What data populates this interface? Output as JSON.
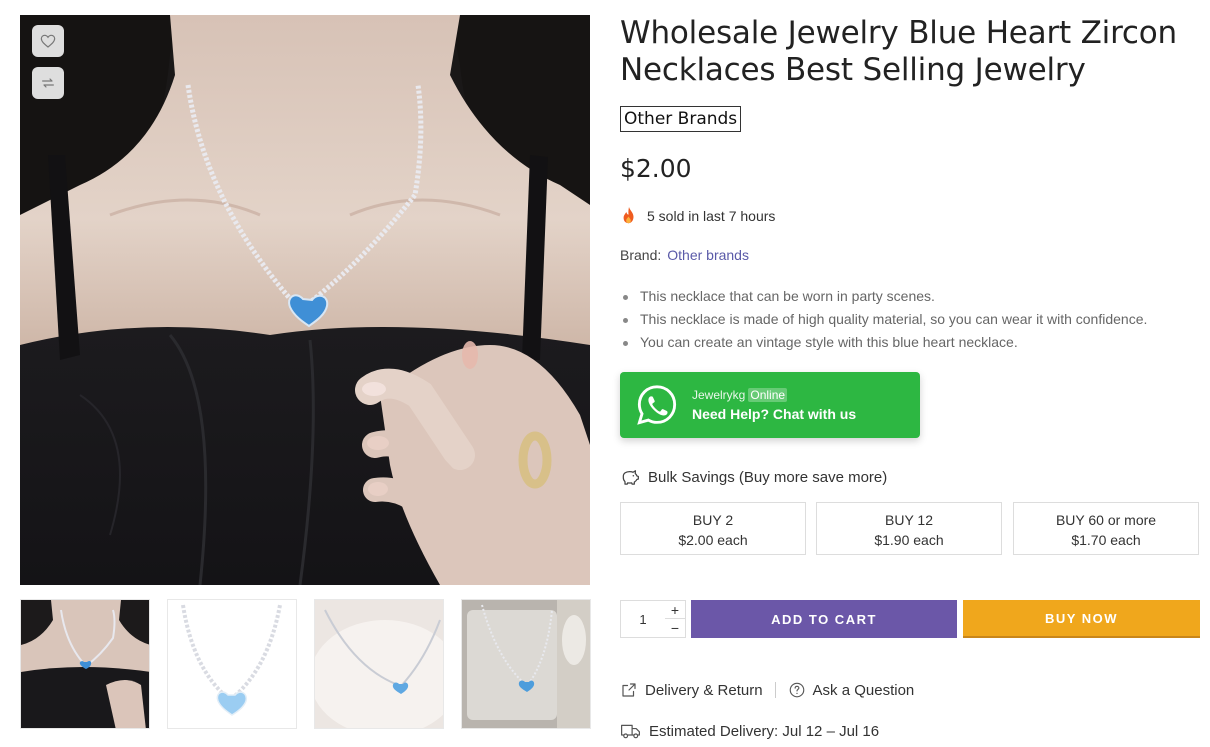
{
  "product": {
    "title": "Wholesale Jewelry Blue Heart Zircon Necklaces Best Selling Jewelry",
    "brand_tag": "Other Brands",
    "price": "$2.00",
    "sold_text": "5 sold in last 7 hours",
    "brand_label": "Brand:",
    "brand_link": "Other brands",
    "bullets": [
      "This necklace that can be worn in party scenes.",
      "This necklace is made of high quality material, so you can wear it with confidence.",
      "You can create an vintage style with this blue heart necklace."
    ]
  },
  "whatsapp": {
    "name": "Jewelrykg",
    "status": "Online",
    "help": "Need Help? Chat with us",
    "color": "#2db742"
  },
  "bulk": {
    "title": "Bulk Savings (Buy more save more)",
    "options": [
      {
        "qty": "BUY 2",
        "price": "$2.00 each"
      },
      {
        "qty": "BUY 12",
        "price": "$1.90 each"
      },
      {
        "qty": "BUY 60 or more",
        "price": "$1.70 each"
      }
    ]
  },
  "cart": {
    "quantity": "1",
    "plus": "+",
    "minus": "−",
    "add_to_cart": "ADD TO CART",
    "buy_now": "BUY NOW",
    "add_color": "#6b57a8",
    "buy_color": "#f0a71c"
  },
  "links": {
    "delivery_return": "Delivery & Return",
    "ask_question": "Ask a Question",
    "estimated_delivery": "Estimated Delivery: Jul 12 – Jul 16"
  },
  "icons": {
    "wishlist": "heart-icon",
    "compare": "compare-arrows-icon",
    "sold": "fire-icon",
    "bulk": "piggy-bank-icon",
    "delivery_return": "share-box-icon",
    "ask_question": "question-circle-icon",
    "estimated_delivery": "truck-icon"
  }
}
